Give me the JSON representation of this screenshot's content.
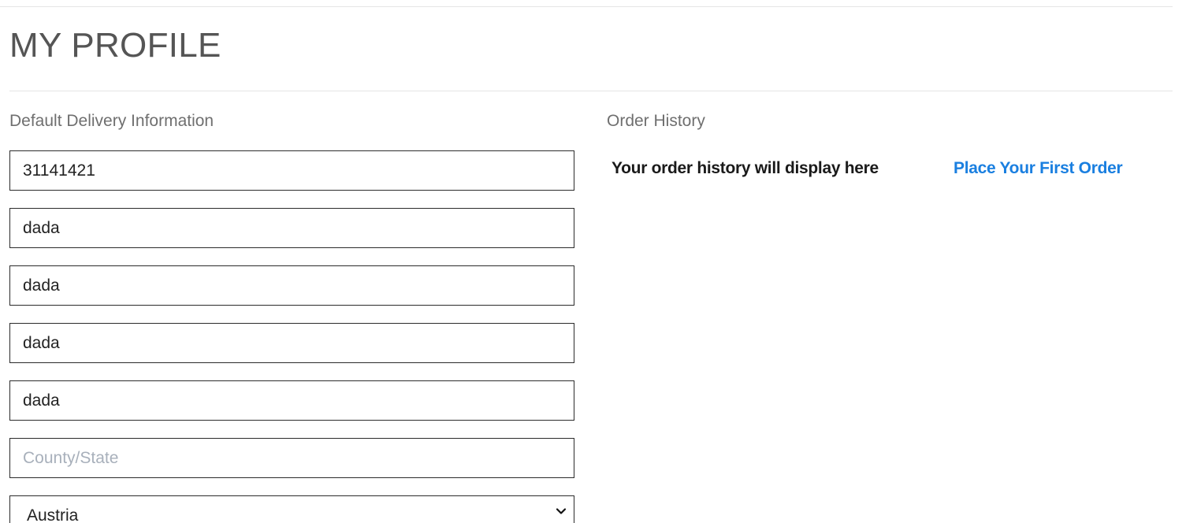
{
  "page": {
    "title": "MY PROFILE"
  },
  "delivery": {
    "heading": "Default Delivery Information",
    "fields": [
      {
        "value": "31141421",
        "placeholder": ""
      },
      {
        "value": "dada",
        "placeholder": ""
      },
      {
        "value": "dada",
        "placeholder": ""
      },
      {
        "value": "dada",
        "placeholder": ""
      },
      {
        "value": "dada",
        "placeholder": ""
      },
      {
        "value": "",
        "placeholder": "County/State"
      }
    ],
    "country": {
      "selected": "Austria",
      "icon": "chevron-down-icon"
    }
  },
  "history": {
    "heading": "Order History",
    "empty_text": "Your order history will display here",
    "cta_label": "Place Your First Order"
  },
  "colors": {
    "link": "#1a7fe0",
    "title": "#555555",
    "muted_heading": "#6f6f6f",
    "placeholder": "#a8b0bb",
    "border": "#2b2b2b"
  }
}
